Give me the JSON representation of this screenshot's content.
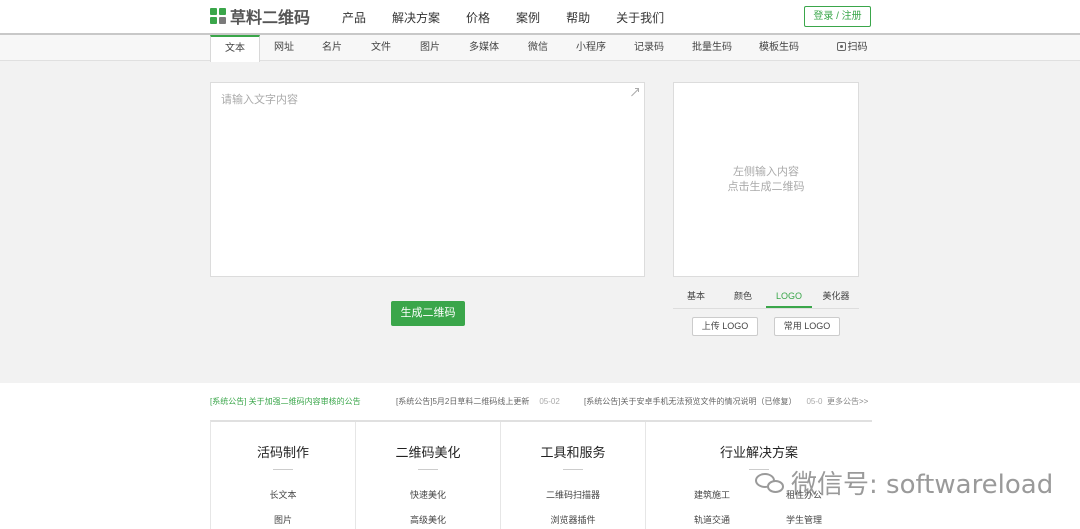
{
  "brand": {
    "name": "草料二维码"
  },
  "nav": [
    "产品",
    "解决方案",
    "价格",
    "案例",
    "帮助",
    "关于我们"
  ],
  "login": "登录 / 注册",
  "tabs": [
    "文本",
    "网址",
    "名片",
    "文件",
    "图片",
    "多媒体",
    "微信",
    "小程序",
    "记录码",
    "批量生码",
    "模板生码",
    "扫码"
  ],
  "active_tab": "文本",
  "editor": {
    "placeholder": "请输入文字内容"
  },
  "generate_button": "生成二维码",
  "preview": {
    "hint_line1": "左侧输入内容",
    "hint_line2": "点击生成二维码"
  },
  "options": {
    "tabs": [
      "基本",
      "颜色",
      "LOGO",
      "美化器"
    ],
    "active": "LOGO",
    "upload_logo": "上传 LOGO",
    "common_logo": "常用 LOGO"
  },
  "notices": [
    {
      "text": "[系统公告] 关于加强二维码内容审核的公告",
      "date": ""
    },
    {
      "text": "[系统公告]5月2日草料二维码线上更新",
      "date": "05-02"
    },
    {
      "text": "[系统公告]关于安卓手机无法预览文件的情况说明（已修复）",
      "date": "05-0"
    }
  ],
  "more": "更多公告>>",
  "categories": [
    {
      "title": "活码制作",
      "links": [
        "长文本",
        "图片"
      ]
    },
    {
      "title": "二维码美化",
      "links": [
        "快速美化",
        "高级美化"
      ]
    },
    {
      "title": "工具和服务",
      "links": [
        "二维码扫描器",
        "浏览器插件"
      ]
    },
    {
      "title": "行业解决方案",
      "links": [
        "建筑施工",
        "轨道交通",
        "租住办公",
        "学生管理"
      ]
    }
  ],
  "watermark": "微信号: softwareload",
  "colors": {
    "accent": "#3aa64a",
    "background": "#f2f2f2",
    "border": "#dcdcdc"
  }
}
